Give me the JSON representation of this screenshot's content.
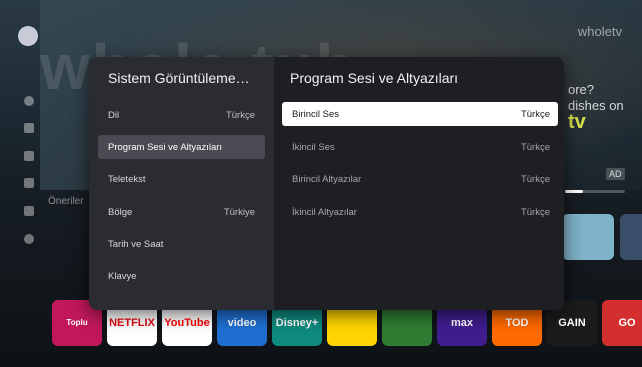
{
  "background": {
    "brand_watermark": "whole tub",
    "brand_top_right": "wholetv",
    "promo_line1": "ore?",
    "promo_line2": "dishes on",
    "promo_brand": "tv",
    "ad_badge": "AD",
    "recommendations_label": "Öneriler",
    "apps": [
      {
        "name": "Toolbox-app-tile",
        "label": "Toplu",
        "color": "#c2185b"
      },
      {
        "name": "netflix-tile",
        "label": "NETFLIX",
        "color": "#ffffff",
        "text": "#e50914"
      },
      {
        "name": "youtube-tile",
        "label": "YouTube",
        "color": "#ffffff",
        "text": "#ff0000"
      },
      {
        "name": "video-tile",
        "label": "video",
        "color": "#1f6fd1"
      },
      {
        "name": "disney-tile",
        "label": "Disney+",
        "color": "#0e8a7e"
      },
      {
        "name": "app-tile-yellow",
        "label": "",
        "color": "#ffd400"
      },
      {
        "name": "app-tile-green",
        "label": "",
        "color": "#2e7d32"
      },
      {
        "name": "hbomax-tile",
        "label": "max",
        "color": "#3f1d8e"
      },
      {
        "name": "app-tile-orange",
        "label": "TOD",
        "color": "#ff6a00"
      },
      {
        "name": "gain-tile",
        "label": "GAIN",
        "color": "#1b1b1b"
      },
      {
        "name": "gosmart-tile",
        "label": "GO",
        "color": "#d32f2f"
      }
    ]
  },
  "dialog": {
    "left_title": "Sistem Görüntüleme…",
    "menu": [
      {
        "label": "Dil",
        "value": "Türkçe"
      },
      {
        "label": "Program Sesi ve Altyazıları",
        "value": ""
      },
      {
        "label": "Teletekst",
        "value": ""
      },
      {
        "label": "Bölge",
        "value": "Türkiye"
      },
      {
        "label": "Tarih ve Saat",
        "value": ""
      },
      {
        "label": "Klavye",
        "value": ""
      }
    ],
    "right_title": "Program Sesi ve Altyazıları",
    "options": [
      {
        "label": "Birincil Ses",
        "value": "Türkçe"
      },
      {
        "label": "İkincil Ses",
        "value": "Türkçe"
      },
      {
        "label": "Birincil Altyazılar",
        "value": "Türkçe"
      },
      {
        "label": "İkincil Altyazılar",
        "value": "Türkçe"
      }
    ]
  },
  "colors": {
    "focused_bg": "#ffffff",
    "active_bg": "#4a4b52",
    "panel_left": "#2b2c31",
    "panel_right": "#1e1f23"
  }
}
